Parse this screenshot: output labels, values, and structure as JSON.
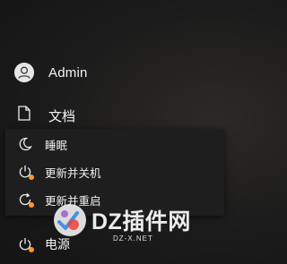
{
  "user": {
    "name": "Admin",
    "icon": "user-avatar-icon"
  },
  "documents": {
    "label": "文档",
    "icon": "document-icon"
  },
  "power_menu": {
    "items": [
      {
        "label": "睡眠",
        "icon": "moon-icon"
      },
      {
        "label": "更新并关机",
        "icon": "power-update-icon"
      },
      {
        "label": "更新并重启",
        "icon": "restart-update-icon"
      }
    ]
  },
  "power": {
    "label": "电源",
    "icon": "power-icon"
  },
  "watermark": {
    "brand": "DZ插件网",
    "url": "DZ-X.NET"
  },
  "colors": {
    "update_badge": "#ff9a1f",
    "flyout_background": "#1e1e1e",
    "text": "#f4f4f4"
  }
}
